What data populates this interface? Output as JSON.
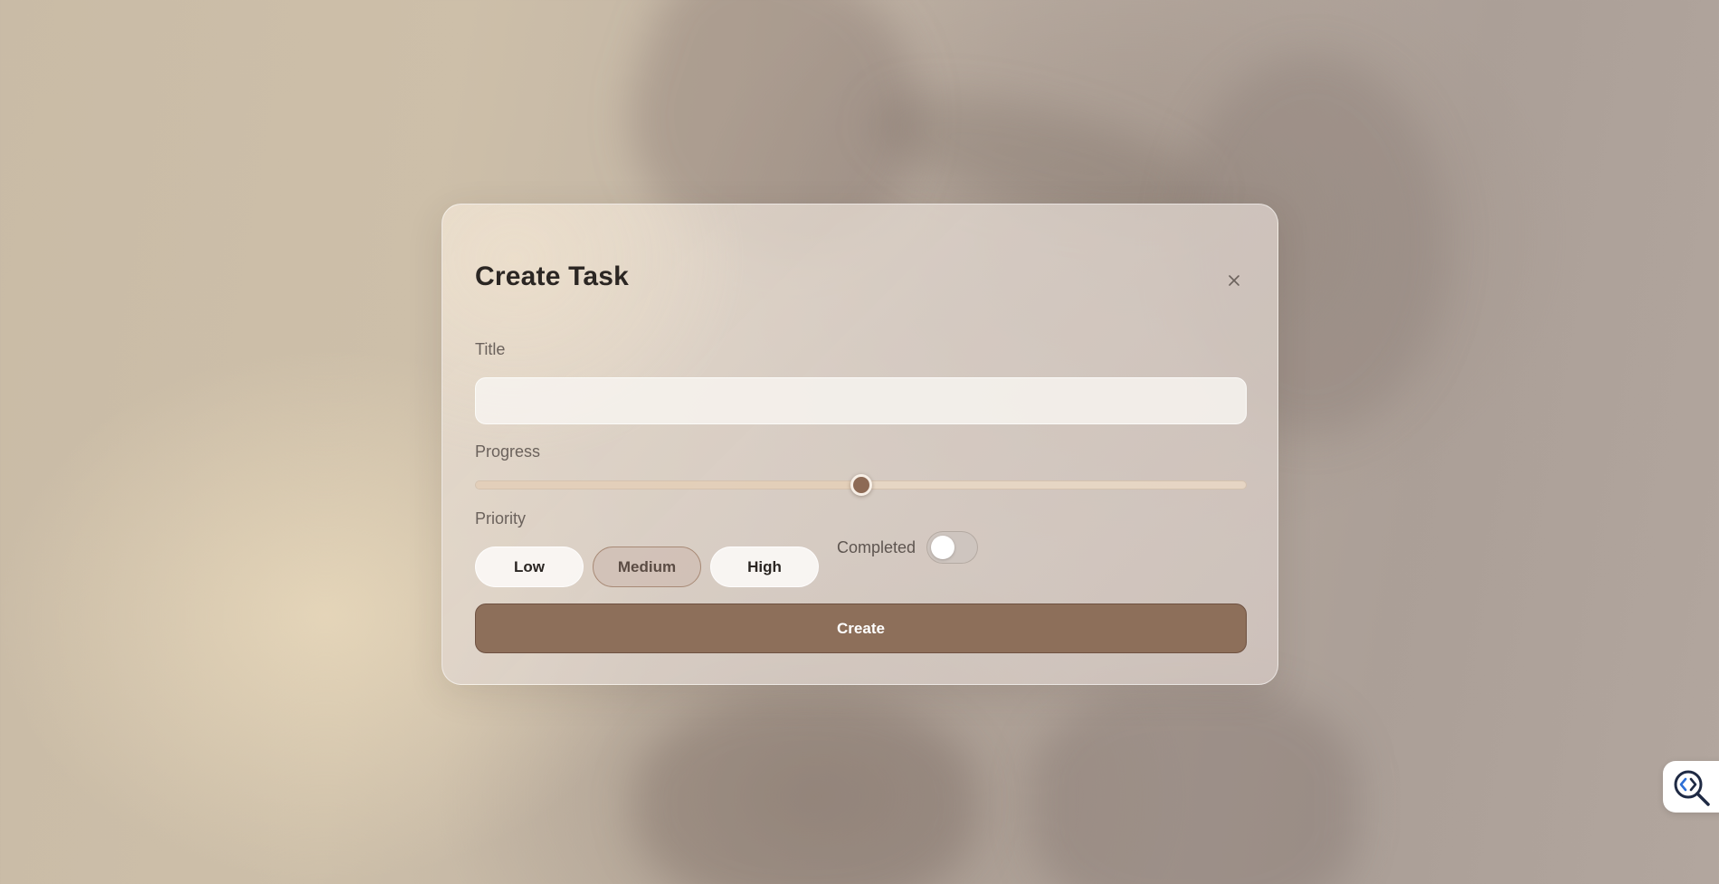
{
  "dialog": {
    "title": "Create Task",
    "close_icon": "close-icon",
    "fields": {
      "title_label": "Title",
      "title_value": "",
      "title_placeholder": "",
      "progress_label": "Progress",
      "progress_value": 0.5,
      "priority_label": "Priority",
      "priority_options": [
        "Low",
        "Medium",
        "High"
      ],
      "priority_selected": "Medium",
      "completed_label": "Completed",
      "completed_on": false
    },
    "create_label": "Create"
  },
  "corner_widget": {
    "icon": "code-search-icon"
  },
  "colors": {
    "accent": "#8d6f5a",
    "slider_thumb": "#8d6a55",
    "text_dark": "#2b2623",
    "label_text": "#6b625c"
  }
}
